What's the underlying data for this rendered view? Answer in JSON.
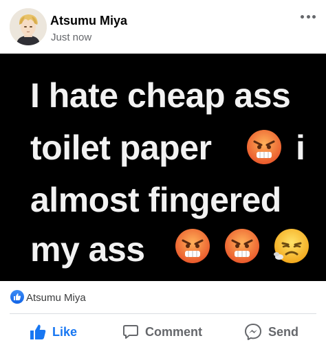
{
  "post": {
    "author": "Atsumu Miya",
    "timestamp": "Just now",
    "more_icon": "more-horizontal-icon",
    "avatar_icon": "profile-avatar"
  },
  "image": {
    "lines": [
      "I hate cheap ass",
      "toilet paper",
      "i",
      "almost fingered",
      "my ass"
    ],
    "emojis": [
      "angry-face-icon",
      "angry-face-icon",
      "angry-face-icon",
      "tired-face-icon"
    ],
    "background": "#000000",
    "text_color": "#f2f2f2"
  },
  "reactions": {
    "icon": "like-reaction-icon",
    "names": "Atsumu Miya"
  },
  "actions": {
    "like_label": "Like",
    "comment_label": "Comment",
    "send_label": "Send"
  },
  "colors": {
    "accent": "#1877f2",
    "secondary_text": "#65676b",
    "divider": "#dadde1"
  }
}
